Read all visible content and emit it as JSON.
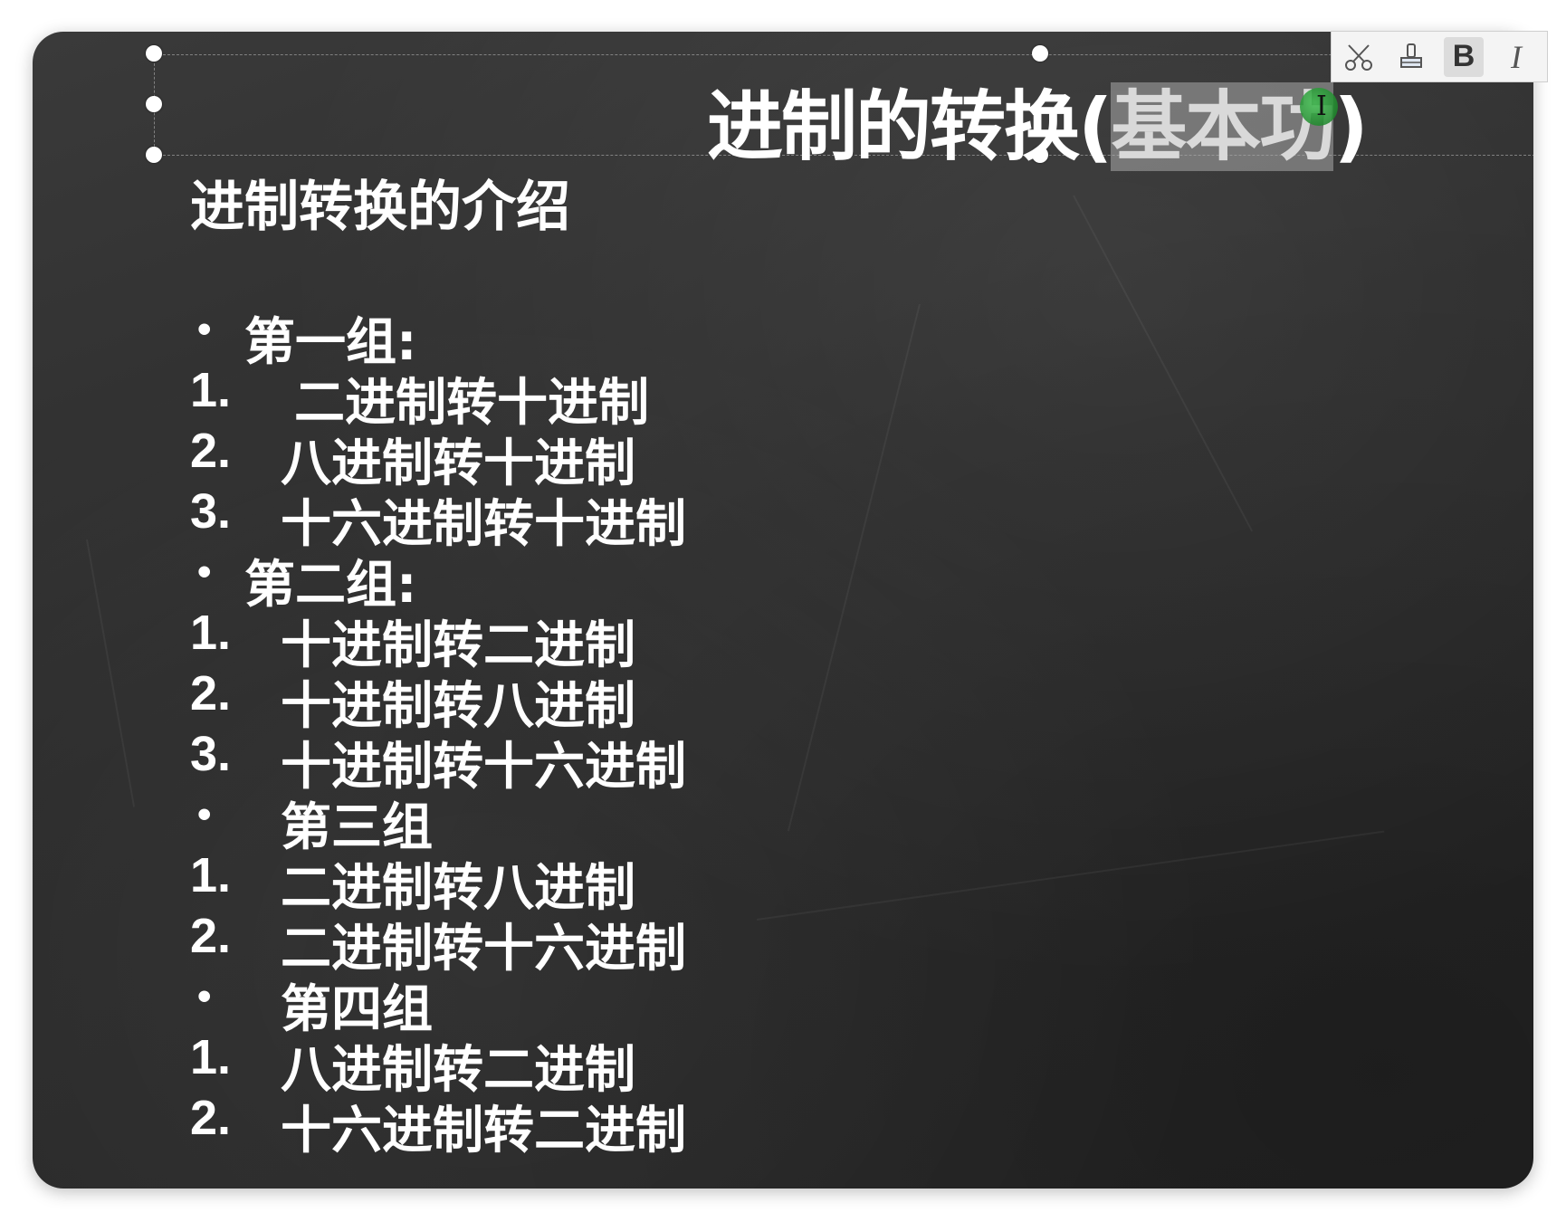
{
  "slide": {
    "title_plain": "进制的转换(",
    "title_selected": "基本功",
    "title_close": ")",
    "subtitle": "进制转换的介绍"
  },
  "toolbar": {
    "cut_icon": "scissors-icon",
    "format_painter_icon": "format-painter-icon",
    "bold_label": "B",
    "italic_label": "I"
  },
  "items": [
    {
      "marker": "•",
      "text": "第一组:",
      "kind": "bullet",
      "indent": "narrow"
    },
    {
      "marker": "1.",
      "text": "二进制转十进制",
      "kind": "number",
      "indent": "wider"
    },
    {
      "marker": "2.",
      "text": "八进制转十进制",
      "kind": "number",
      "indent": "wide"
    },
    {
      "marker": "3.",
      "text": "十六进制转十进制",
      "kind": "number",
      "indent": "wide"
    },
    {
      "marker": "•",
      "text": "第二组:",
      "kind": "bullet",
      "indent": "narrow"
    },
    {
      "marker": "1.",
      "text": "十进制转二进制",
      "kind": "number",
      "indent": "wide"
    },
    {
      "marker": "2.",
      "text": "十进制转八进制",
      "kind": "number",
      "indent": "wide"
    },
    {
      "marker": "3.",
      "text": "十进制转十六进制",
      "kind": "number",
      "indent": "wide"
    },
    {
      "marker": "•",
      "text": "第三组",
      "kind": "bullet",
      "indent": "wide"
    },
    {
      "marker": "1.",
      "text": "二进制转八进制",
      "kind": "number",
      "indent": "wide"
    },
    {
      "marker": "2.",
      "text": "二进制转十六进制",
      "kind": "number",
      "indent": "wide"
    },
    {
      "marker": "•",
      "text": "第四组",
      "kind": "bullet",
      "indent": "wide"
    },
    {
      "marker": "1.",
      "text": "八进制转二进制",
      "kind": "number",
      "indent": "wide"
    },
    {
      "marker": "2.",
      "text": "十六进制转二进制",
      "kind": "number",
      "indent": "wide"
    }
  ]
}
